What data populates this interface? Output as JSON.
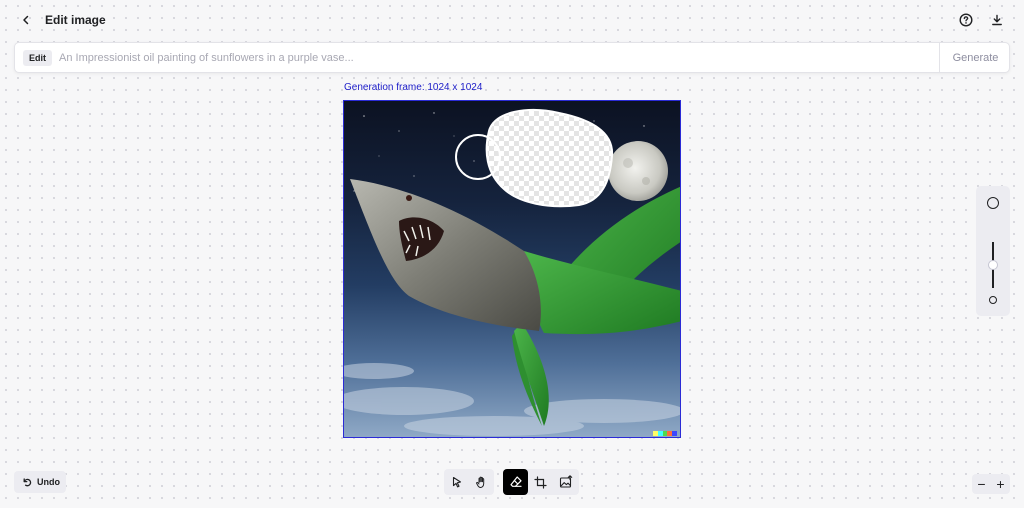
{
  "header": {
    "title": "Edit image",
    "icons": {
      "back": "chevron-left-icon",
      "help": "question-circle-icon",
      "download": "download-icon"
    }
  },
  "prompt": {
    "tag": "Edit",
    "placeholder": "An Impressionist oil painting of sunflowers in a purple vase...",
    "value": "",
    "generate_label": "Generate"
  },
  "canvas": {
    "frame_label": "Generation frame: 1024 x 1024",
    "frame_color": "#2b2bd6",
    "watermark_colors": [
      "#ffff66",
      "#42ffff",
      "#51da4c",
      "#ff6e3c",
      "#3c46ff"
    ]
  },
  "zoom": {
    "level_fraction": 0.5,
    "icons": {
      "large": "brush-large-icon",
      "small": "brush-small-icon"
    }
  },
  "undo": {
    "label": "Undo",
    "icon": "undo-icon"
  },
  "toolbar": {
    "tools": [
      {
        "name": "select",
        "icon": "cursor-arrow-icon"
      },
      {
        "name": "pan",
        "icon": "hand-icon"
      },
      {
        "name": "eraser",
        "icon": "eraser-icon",
        "active": true
      },
      {
        "name": "add-frame",
        "icon": "frame-crop-icon"
      },
      {
        "name": "upload",
        "icon": "image-upload-icon"
      }
    ]
  },
  "zoom_buttons": {
    "minus": "−",
    "plus": "+"
  },
  "colors": {
    "accent": "#000000",
    "frame_label": "#1c1cc8",
    "panel": "#ececf1"
  }
}
